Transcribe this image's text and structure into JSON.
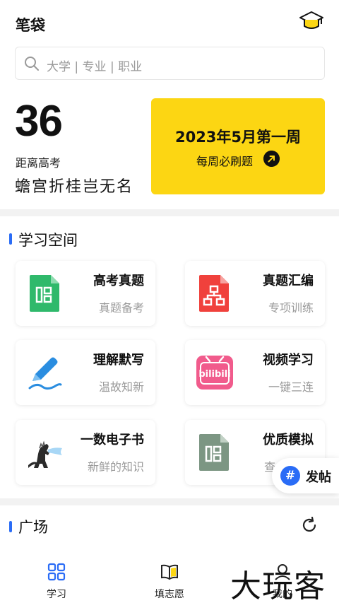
{
  "app": {
    "title": "笔袋"
  },
  "search": {
    "placeholder": "大学 | 专业 | 职业"
  },
  "countdown": {
    "days": "36",
    "label": "距离高考",
    "slogan": "蟾宫折桂岂无名"
  },
  "weekly": {
    "title": "2023年5月第一周",
    "subtitle": "每周必刷题"
  },
  "study_section": {
    "title": "学习空间"
  },
  "cards": [
    {
      "title": "高考真题",
      "subtitle": "真题备考",
      "icon": "green-document-icon"
    },
    {
      "title": "真题汇编",
      "subtitle": "专项训练",
      "icon": "red-document-icon"
    },
    {
      "title": "理解默写",
      "subtitle": "温故知新",
      "icon": "pen-writing-icon"
    },
    {
      "title": "视频学习",
      "subtitle": "一键三连",
      "icon": "bilibili-icon"
    },
    {
      "title": "一数电子书",
      "subtitle": "新鲜的知识",
      "icon": "godzilla-icon"
    },
    {
      "title": "优质模拟",
      "subtitle": "查",
      "icon": "gray-document-icon"
    }
  ],
  "post_button": {
    "icon_glyph": "#",
    "label": "发帖"
  },
  "square_section": {
    "title": "广场"
  },
  "tabbar": {
    "items": [
      {
        "label": "学习",
        "icon": "grid-icon"
      },
      {
        "label": "填志愿",
        "icon": "book-icon"
      },
      {
        "label": "我的",
        "icon": "profile-icon"
      }
    ]
  },
  "watermark": {
    "text": "大玩客"
  },
  "colors": {
    "accent": "#2a6cf6",
    "weekly_bg": "#fcd613",
    "subtitle_gray": "#9a9a9a"
  }
}
